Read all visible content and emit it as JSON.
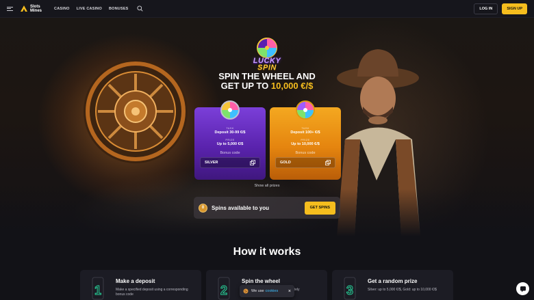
{
  "header": {
    "brand_line1": "Slots",
    "brand_line2": "Mines",
    "nav": [
      "CASINO",
      "LIVE CASINO",
      "BONUSES"
    ],
    "login_label": "LOG IN",
    "signup_label": "SIGN UP"
  },
  "promo": {
    "logo_line1": "LUCKY",
    "logo_line2": "SPIN",
    "headline_line1": "SPIN THE WHEEL AND",
    "headline_prefix": "GET UP TO ",
    "headline_amount": "10,000 €/$",
    "cards": [
      {
        "task_label": "TASK",
        "task_value": "Deposit 30-99 €/$",
        "prize_label": "PRIZE",
        "prize_value": "Up to 5,000 €/$",
        "bonus_label": "Bonus code",
        "code": "SILVER"
      },
      {
        "task_label": "TASK",
        "task_value": "Deposit 100+ €/$",
        "prize_label": "PRIZE",
        "prize_value": "Up to 10,000 €/$",
        "bonus_label": "Bonus code",
        "code": "GOLD"
      }
    ],
    "show_all_label": "Show all prizes",
    "spins_count": "0",
    "spins_label": "Spins available to you",
    "get_spins_label": "GET SPINS"
  },
  "how": {
    "title": "How it works",
    "steps": [
      {
        "title": "Make a deposit",
        "desc": "Make a specified deposit using a corresponding bonus code"
      },
      {
        "title": "Spin the wheel",
        "desc": "ately"
      },
      {
        "title": "Get a random prize",
        "desc": "Silver: up to 5,000 €/$, Gold: up to 10,000 €/$"
      }
    ]
  },
  "cookie": {
    "prefix": "We use",
    "link": "cookies",
    "close": "×"
  },
  "icons": {
    "menu": "menu-icon",
    "search": "search-icon",
    "copy": "copy-icon",
    "chat": "chat-icon",
    "cookie": "cookie-icon"
  },
  "colors": {
    "accent": "#f5bd1e",
    "silver_card": "#6a2fc4",
    "gold_card": "#eb9317",
    "background": "#121217",
    "link": "#3ec0ff"
  }
}
